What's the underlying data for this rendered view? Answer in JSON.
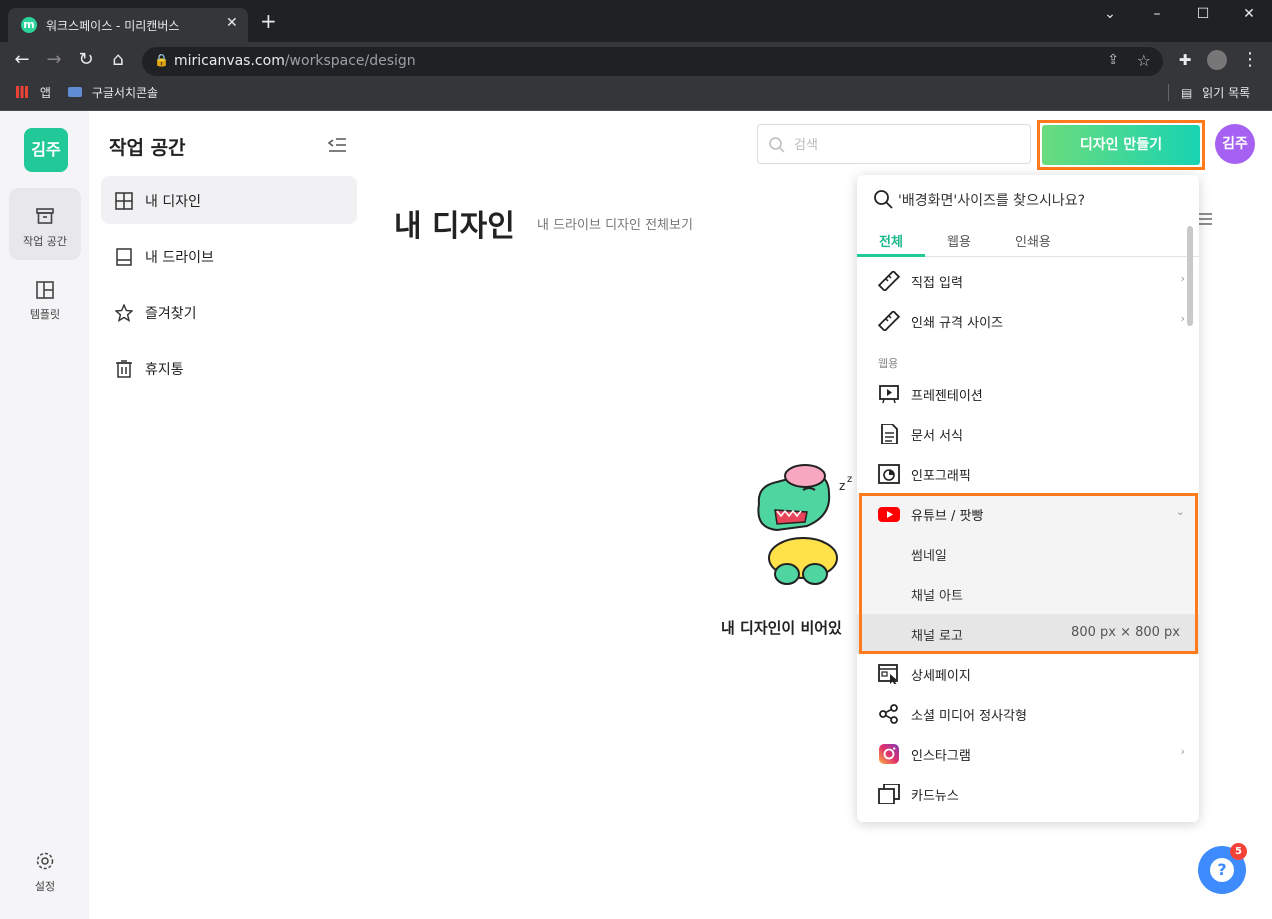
{
  "browser": {
    "tab_title": "워크스페이스 - 미리캔버스",
    "tab_favicon": "m",
    "url_host": "miricanvas.com",
    "url_path": "/workspace/design",
    "bookmarks": [
      "앱",
      "구글서치콘솔"
    ],
    "reading_list": "읽기 목록"
  },
  "rail": {
    "logo": "김주",
    "items": [
      {
        "label": "작업 공간",
        "icon": "archive-icon"
      },
      {
        "label": "템플릿",
        "icon": "layout-icon"
      }
    ],
    "settings": "설정"
  },
  "panel": {
    "title": "작업 공간",
    "items": [
      {
        "label": "내 디자인",
        "icon": "grid-icon"
      },
      {
        "label": "내 드라이브",
        "icon": "drive-icon"
      },
      {
        "label": "즐겨찾기",
        "icon": "star-icon"
      },
      {
        "label": "휴지통",
        "icon": "trash-icon"
      }
    ]
  },
  "header": {
    "search_placeholder": "검색",
    "make_design": "디자인 만들기",
    "avatar": "김주"
  },
  "main": {
    "title": "내 디자인",
    "subtitle": "내 드라이브 디자인 전체보기",
    "empty_text": "내 디자인이 비어있"
  },
  "dropdown": {
    "search_text": "'배경화면'사이즈를 찾으시나요?",
    "tabs": [
      "전체",
      "웹용",
      "인쇄용"
    ],
    "items": {
      "direct": "직접 입력",
      "print_size": "인쇄 규격 사이즈",
      "section_web": "웹용",
      "presentation": "프레젠테이션",
      "document": "문서 서식",
      "infographic": "인포그래픽",
      "youtube": "유튜브 / 팟빵",
      "thumbnail": "썸네일",
      "channel_art": "채널 아트",
      "channel_logo": "채널 로고",
      "channel_logo_size": "800 px × 800 px",
      "detail_page": "상세페이지",
      "social_square": "소셜 미디어 정사각형",
      "instagram": "인스타그램",
      "cardnews": "카드뉴스"
    }
  },
  "help_badge": "5",
  "colors": {
    "accent": "#20c997",
    "highlight": "#ff7a1a",
    "avatar": "#a461f2"
  }
}
